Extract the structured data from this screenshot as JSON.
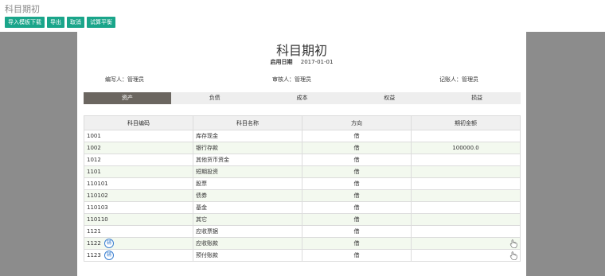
{
  "app_title": "科目期初",
  "toolbar": {
    "buttons": [
      "导入模板下载",
      "导出",
      "取消",
      "试算平衡"
    ]
  },
  "doc": {
    "title": "科目期初",
    "start_date_label": "启用日期",
    "start_date": "2017-01-01",
    "preparer": "编写人：管理员",
    "reviewer": "审核人：管理员",
    "bookkeeper": "记账人：管理员"
  },
  "tabs": [
    {
      "label": "资产",
      "active": true
    },
    {
      "label": "负债",
      "active": false
    },
    {
      "label": "成本",
      "active": false
    },
    {
      "label": "权益",
      "active": false
    },
    {
      "label": "损益",
      "active": false
    }
  ],
  "table": {
    "headers": [
      "科目编码",
      "科目名称",
      "方向",
      "期初金额"
    ],
    "rows": [
      {
        "code": "1001",
        "name": "库存现金",
        "dir": "借",
        "amount": ""
      },
      {
        "code": "1002",
        "name": "银行存款",
        "dir": "借",
        "amount": "100000.0"
      },
      {
        "code": "1012",
        "name": "其他货币资金",
        "dir": "借",
        "amount": ""
      },
      {
        "code": "1101",
        "name": "短期投资",
        "dir": "借",
        "amount": ""
      },
      {
        "code": "110101",
        "name": "股票",
        "dir": "借",
        "amount": ""
      },
      {
        "code": "110102",
        "name": "债券",
        "dir": "借",
        "amount": ""
      },
      {
        "code": "110103",
        "name": "基金",
        "dir": "借",
        "amount": ""
      },
      {
        "code": "110110",
        "name": "其它",
        "dir": "借",
        "amount": ""
      },
      {
        "code": "1121",
        "name": "应收票据",
        "dir": "借",
        "amount": ""
      },
      {
        "code": "1122",
        "name": "应收账款",
        "dir": "借",
        "amount": "",
        "badge": "辅"
      },
      {
        "code": "1123",
        "name": "预付账款",
        "dir": "借",
        "amount": "",
        "badge": "辅"
      }
    ]
  },
  "icons": {
    "badge": "auxiliary-badge-icon",
    "hand": "hand-pointer-icon"
  },
  "colors": {
    "button_green": "#1aa58a",
    "active_tab": "#6b6660",
    "badge_blue": "#3a7fd0"
  }
}
